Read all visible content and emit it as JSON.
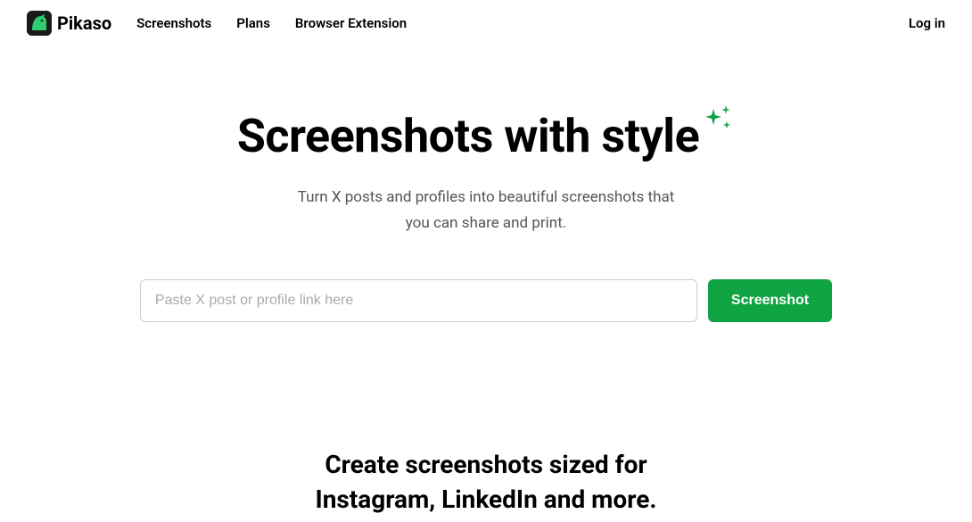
{
  "header": {
    "logo_text": "Pikaso",
    "nav": [
      {
        "label": "Screenshots"
      },
      {
        "label": "Plans"
      },
      {
        "label": "Browser Extension"
      }
    ],
    "login_label": "Log in"
  },
  "hero": {
    "title": "Screenshots with style",
    "subtitle_line1": "Turn X posts and profiles into beautiful screenshots that",
    "subtitle_line2": "you can share and print."
  },
  "input": {
    "placeholder": "Paste X post or profile link here",
    "button_label": "Screenshot"
  },
  "section2": {
    "title_line1": "Create screenshots sized for",
    "title_line2": "Instagram, LinkedIn and more."
  },
  "colors": {
    "accent": "#10a344"
  }
}
